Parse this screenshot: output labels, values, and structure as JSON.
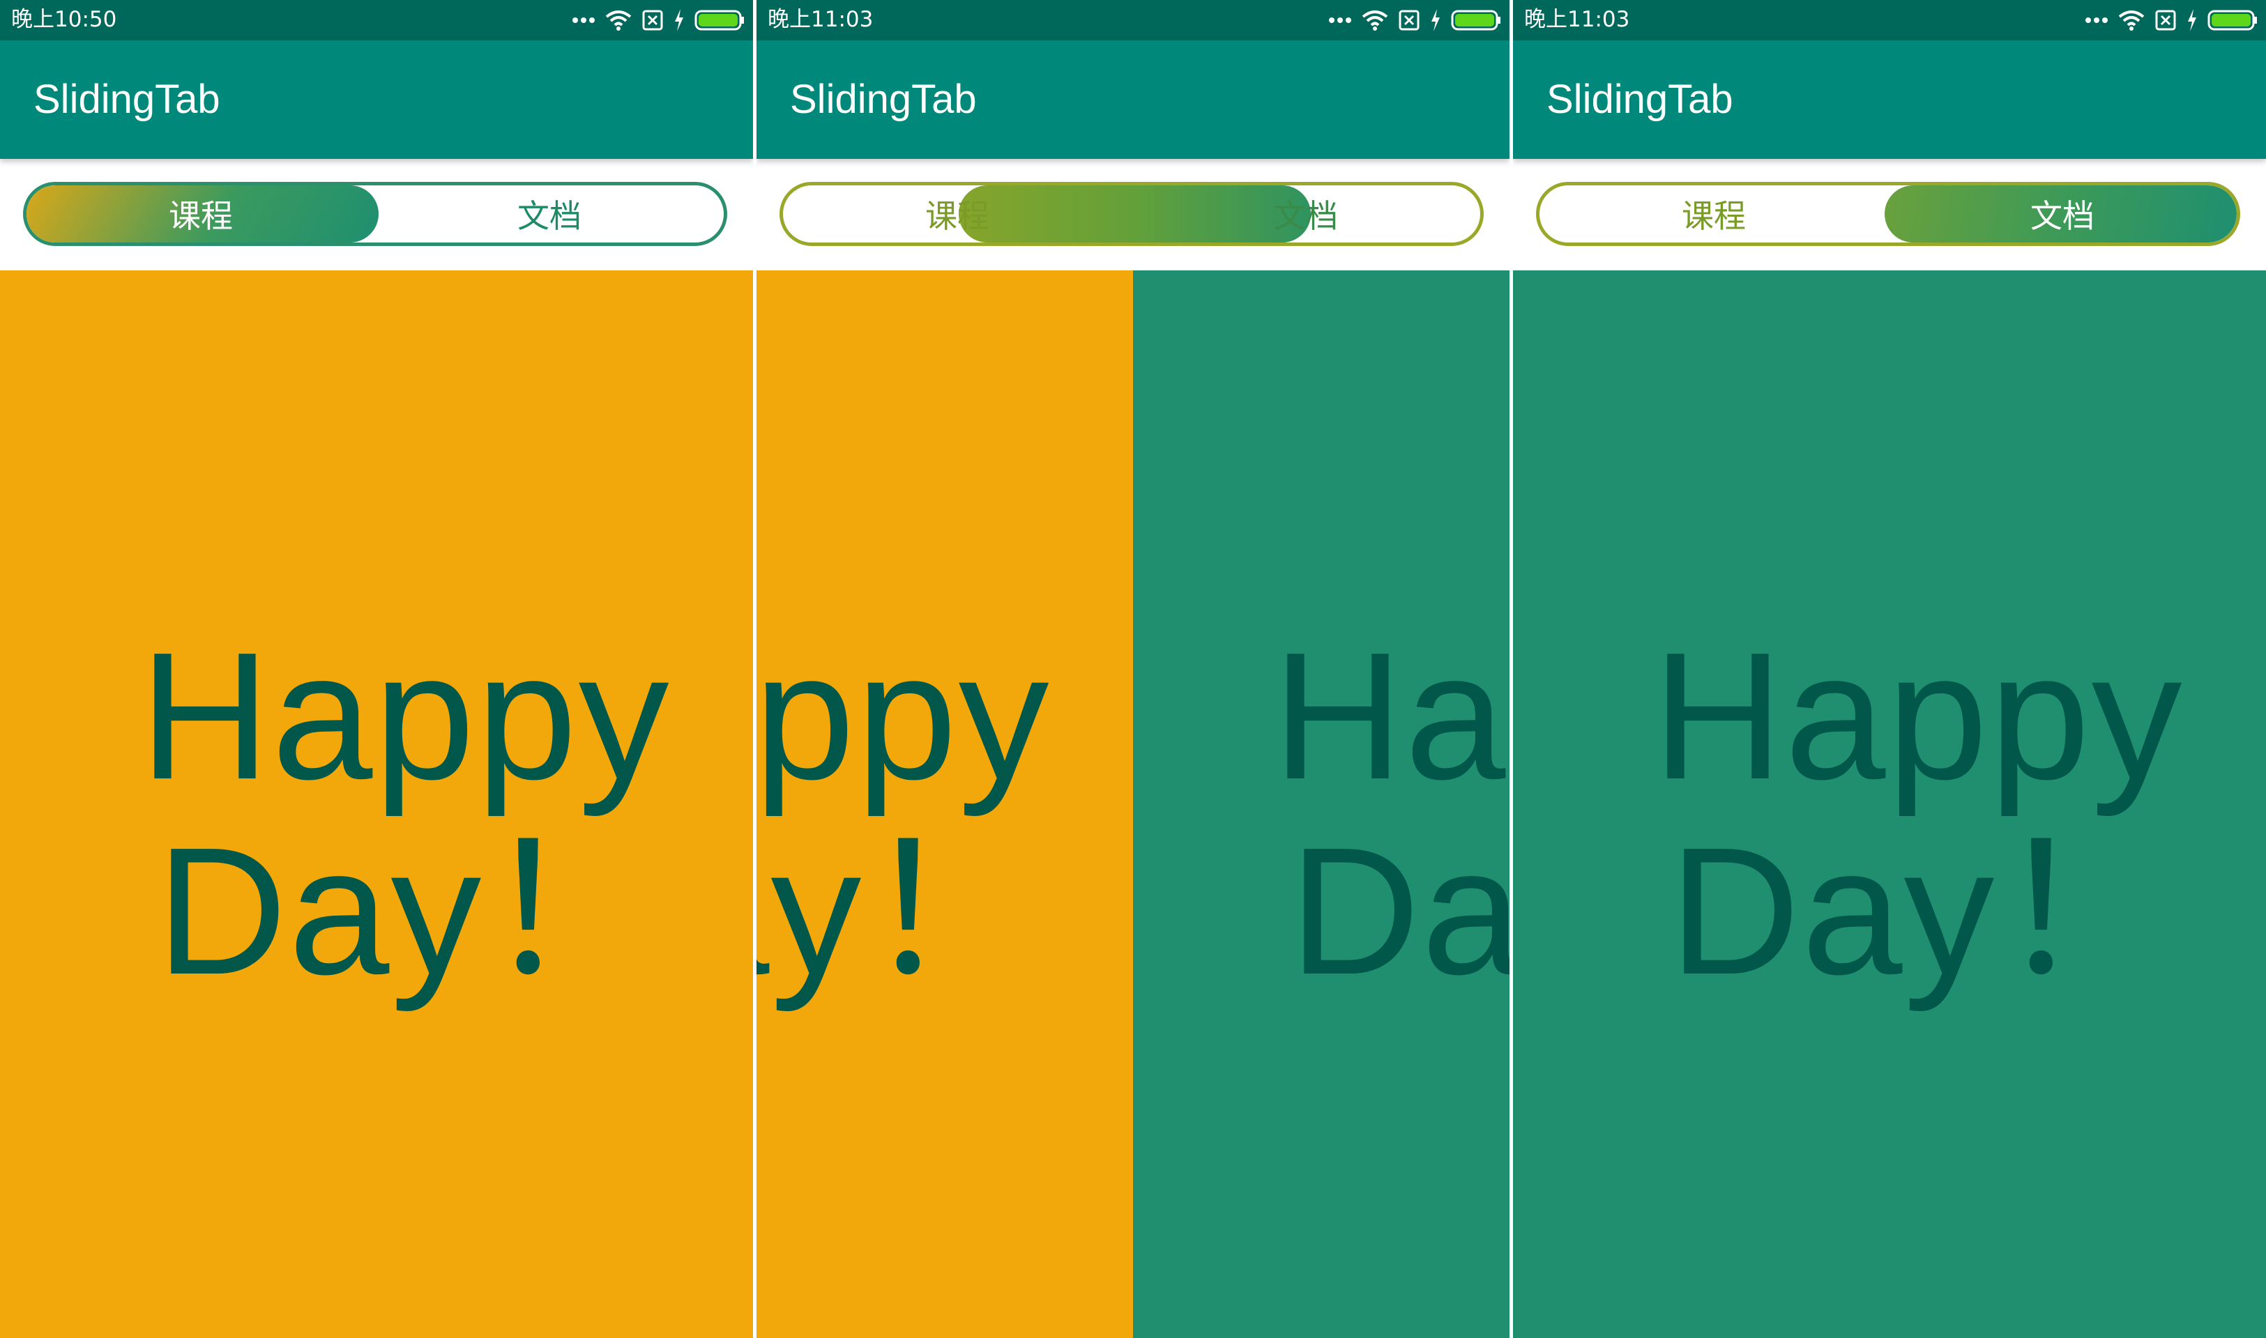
{
  "colors": {
    "statusbar": "#00675b",
    "appbar": "#00897b",
    "page_orange": "#f2a80b",
    "page_green": "#208f6f",
    "text_dark": "#00574a",
    "tab_green": "#2a8f6c",
    "tab_olive": "#7a9b27"
  },
  "screens": [
    {
      "status": {
        "time": "晚上10:50",
        "icons": [
          "more-dots-icon",
          "wifi-icon",
          "no-sim-icon",
          "charging-icon",
          "battery-icon"
        ]
      },
      "app_title": "SlidingTab",
      "tabs": [
        {
          "label": "课程"
        },
        {
          "label": "文档"
        }
      ],
      "selected_tab_progress": 0,
      "page_text": {
        "line1": "Happy",
        "line2": "Day！"
      }
    },
    {
      "status": {
        "time": "晚上11:03",
        "icons": [
          "more-dots-icon",
          "wifi-icon",
          "no-sim-icon",
          "charging-icon",
          "battery-icon"
        ]
      },
      "app_title": "SlidingTab",
      "tabs": [
        {
          "label": "课程"
        },
        {
          "label": "文档"
        }
      ],
      "selected_tab_progress": 0.5,
      "page_text": {
        "line1": "Happy",
        "line2": "Day！"
      }
    },
    {
      "status": {
        "time": "晚上11:03",
        "icons": [
          "more-dots-icon",
          "wifi-icon",
          "no-sim-icon",
          "charging-icon",
          "battery-icon"
        ]
      },
      "app_title": "SlidingTab",
      "tabs": [
        {
          "label": "课程"
        },
        {
          "label": "文档"
        }
      ],
      "selected_tab_progress": 1,
      "page_text": {
        "line1": "Happy",
        "line2": "Day！"
      }
    }
  ]
}
